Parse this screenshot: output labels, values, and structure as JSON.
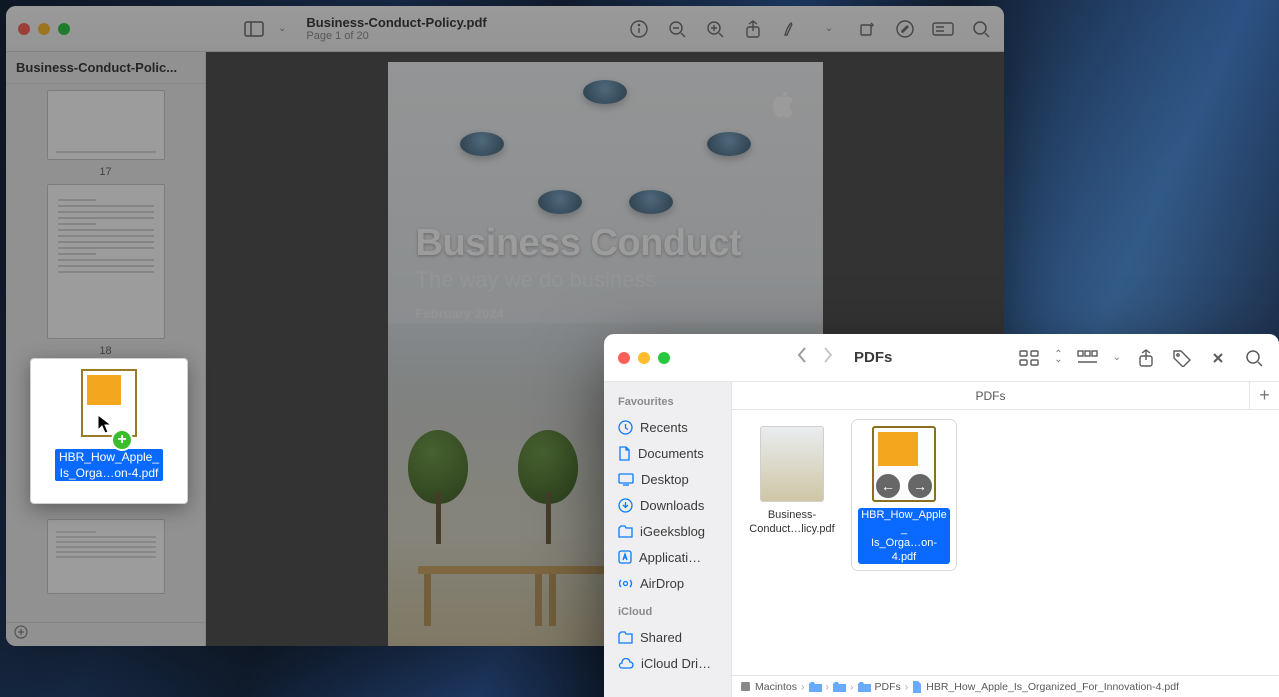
{
  "preview": {
    "title": "Business-Conduct-Policy.pdf",
    "subtitle": "Page 1 of 20",
    "sidebar_title": "Business-Conduct-Polic...",
    "page_numbers": [
      "17",
      "18"
    ],
    "hero": {
      "h1": "Business Conduct",
      "h2": "The way we do business",
      "h3": "February 2024"
    },
    "drag": {
      "label_l1": "HBR_How_Apple_",
      "label_l2": "Is_Orga…on-4.pdf"
    }
  },
  "finder": {
    "location": "PDFs",
    "tab": "PDFs",
    "sidebar": {
      "favourites_head": "Favourites",
      "items": [
        "Recents",
        "Documents",
        "Desktop",
        "Downloads",
        "iGeeksblog",
        "Applicati…",
        "AirDrop"
      ],
      "icloud_head": "iCloud",
      "icloud_items": [
        "Shared",
        "iCloud Dri…"
      ]
    },
    "files": [
      {
        "name": "Business-Conduct…licy.pdf"
      },
      {
        "name_l1": "HBR_How_Apple_",
        "name_l2": "Is_Orga…on-4.pdf"
      }
    ],
    "path": [
      "Macintos",
      "",
      "",
      "PDFs",
      "HBR_How_Apple_Is_Organized_For_Innovation-4.pdf"
    ]
  }
}
